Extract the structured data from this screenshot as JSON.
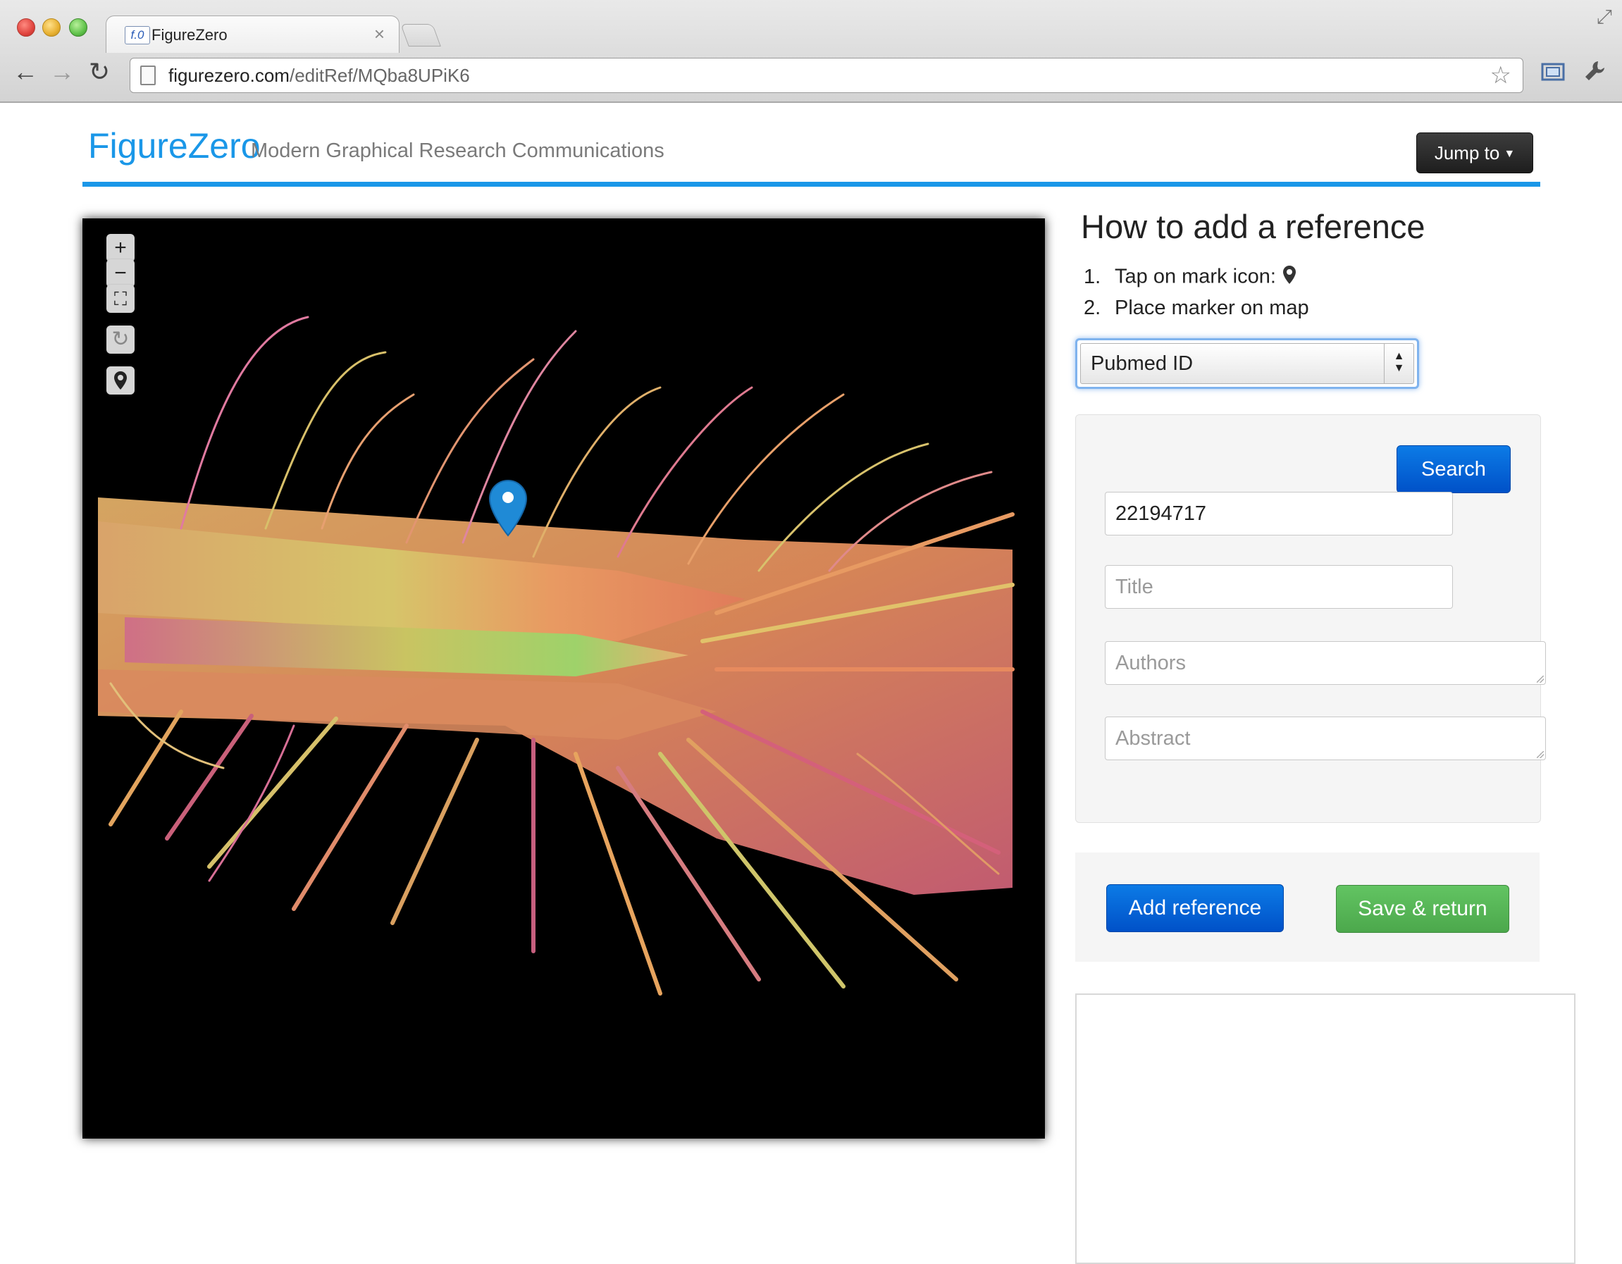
{
  "browser": {
    "tab_title": "FigureZero",
    "tab_favicon_text": "f.0",
    "url_host": "figurezero.com",
    "url_path": "/editRef/MQba8UPiK6",
    "icons": {
      "back": "arrow-left-icon",
      "forward": "arrow-right-icon",
      "reload": "reload-icon",
      "bookmark": "star-icon",
      "fullscreen": "fullscreen-icon",
      "settings": "wrench-icon",
      "close_tab": "close-icon",
      "resize": "resize-icon"
    }
  },
  "header": {
    "brand": "FigureZero",
    "tagline": "Modern Graphical Research Communications",
    "jump_label": "Jump to",
    "accent_color": "#1a97e8"
  },
  "map": {
    "controls": [
      {
        "name": "zoom-in",
        "icon": "plus-icon",
        "glyph": "+"
      },
      {
        "name": "zoom-out",
        "icon": "minus-icon",
        "glyph": "−"
      },
      {
        "name": "fit",
        "icon": "fullscreen-icon",
        "glyph": "⛶"
      },
      {
        "name": "rotate",
        "icon": "rotate-icon",
        "glyph": "↻"
      },
      {
        "name": "mark",
        "icon": "map-marker-icon",
        "glyph": "⚲"
      }
    ],
    "marker_color": "#1f8ad6"
  },
  "instructions": {
    "title": "How to add a reference",
    "steps": [
      {
        "num": "1.",
        "text": "Tap on mark icon:"
      },
      {
        "num": "2.",
        "text": "Place marker on map"
      }
    ]
  },
  "form": {
    "id_type_selected": "Pubmed ID",
    "search_label": "Search",
    "pmid_value": "22194717",
    "title_placeholder": "Title",
    "authors_placeholder": "Authors",
    "abstract_placeholder": "Abstract"
  },
  "actions": {
    "add_label": "Add reference",
    "save_label": "Save & return"
  }
}
